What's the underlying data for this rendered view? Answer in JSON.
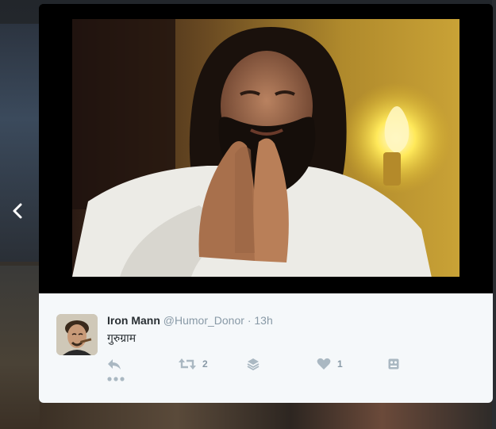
{
  "tweet": {
    "author_name": "Iron Mann",
    "handle": "@Humor_Donor",
    "separator": "·",
    "time": "13h",
    "text": "गुरुग्राम"
  },
  "actions": {
    "reply_icon": "reply-icon",
    "retweet_icon": "retweet-icon",
    "retweet_count": "2",
    "collection_icon": "layers-icon",
    "like_icon": "heart-icon",
    "like_count": "1",
    "media_icon": "media-icon",
    "more_icon": "more-dots-icon"
  },
  "colors": {
    "card_background": "#f5f8fa",
    "icon_gray": "#aab8c2",
    "text_gray": "#8899a6",
    "name_dark": "#292f33"
  }
}
